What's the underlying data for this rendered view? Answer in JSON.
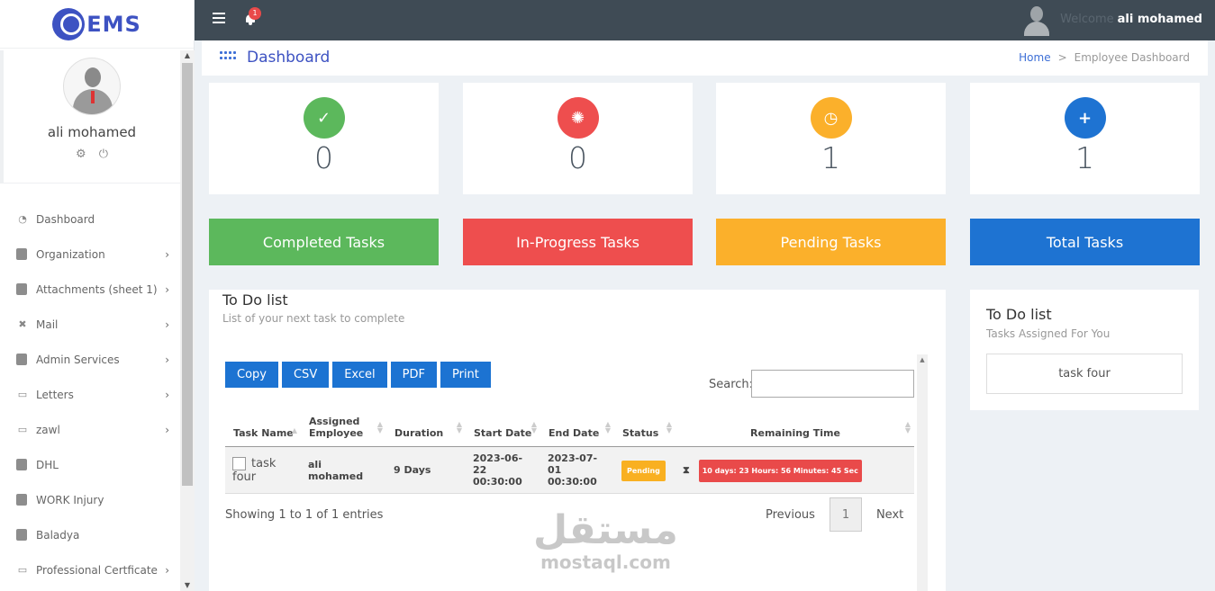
{
  "app": {
    "logo_text": "EMS"
  },
  "topbar": {
    "notification_count": "1",
    "welcome_label": "Welcome",
    "user_name": "ali mohamed"
  },
  "profile": {
    "name": "ali mohamed"
  },
  "sidebar": {
    "items": [
      {
        "label": "Dashboard",
        "icon": "dashboard-icon",
        "arrow": ""
      },
      {
        "label": "Organization",
        "icon": "building-icon",
        "arrow": "›"
      },
      {
        "label": "Attachments (sheet 1)",
        "icon": "clipboard-icon",
        "arrow": "›"
      },
      {
        "label": "Mail",
        "icon": "user-slash-icon",
        "arrow": "›"
      },
      {
        "label": "Admin Services",
        "icon": "list-icon",
        "arrow": "›"
      },
      {
        "label": "Letters",
        "icon": "money-icon",
        "arrow": "›"
      },
      {
        "label": "zawl",
        "icon": "money-icon",
        "arrow": "›"
      },
      {
        "label": "DHL",
        "icon": "briefcase-icon",
        "arrow": ""
      },
      {
        "label": "WORK Injury",
        "icon": "briefcase-icon",
        "arrow": ""
      },
      {
        "label": "Baladya",
        "icon": "briefcase-icon",
        "arrow": ""
      },
      {
        "label": "Professional Certficate",
        "icon": "money-icon",
        "arrow": "›"
      }
    ]
  },
  "header": {
    "title": "Dashboard",
    "breadcrumb_home": "Home",
    "breadcrumb_sep": ">",
    "breadcrumb_current": "Employee Dashboard"
  },
  "stats": [
    {
      "value": "0",
      "label": "Completed Tasks",
      "color": "#5cb85c",
      "icon": "check-icon",
      "glyph": "✓"
    },
    {
      "value": "0",
      "label": "In-Progress Tasks",
      "color": "#ee4e4e",
      "icon": "spinner-icon",
      "glyph": "✺"
    },
    {
      "value": "1",
      "label": "Pending Tasks",
      "color": "#fbb02b",
      "icon": "clock-icon",
      "glyph": "◷"
    },
    {
      "value": "1",
      "label": "Total Tasks",
      "color": "#1e73d2",
      "icon": "plus-icon",
      "glyph": "+"
    }
  ],
  "todo": {
    "title": "To Do list",
    "subtitle": "List of your next task to complete",
    "export_buttons": [
      "Copy",
      "CSV",
      "Excel",
      "PDF",
      "Print"
    ],
    "search_label": "Search:",
    "search_value": "",
    "columns": [
      "Task Name",
      "Assigned Employee",
      "Duration",
      "Start Date",
      "End Date",
      "Status",
      "Remaining Time"
    ],
    "rows": [
      {
        "task": "task four",
        "employee": "ali mohamed",
        "duration": "9 Days",
        "start": "2023-06-22 00:30:00",
        "end": "2023-07-01 00:30:00",
        "status": "Pending",
        "remaining": "10 days: 23 Hours: 56 Minutes: 45 Sec"
      }
    ],
    "info": "Showing 1 to 1 of 1 entries",
    "prev": "Previous",
    "page": "1",
    "next": "Next"
  },
  "side_todo": {
    "title": "To Do list",
    "subtitle": "Tasks Assigned For You",
    "items": [
      "task four"
    ]
  },
  "watermark": {
    "arabic": "مستقل",
    "latin": "mostaql.com"
  }
}
